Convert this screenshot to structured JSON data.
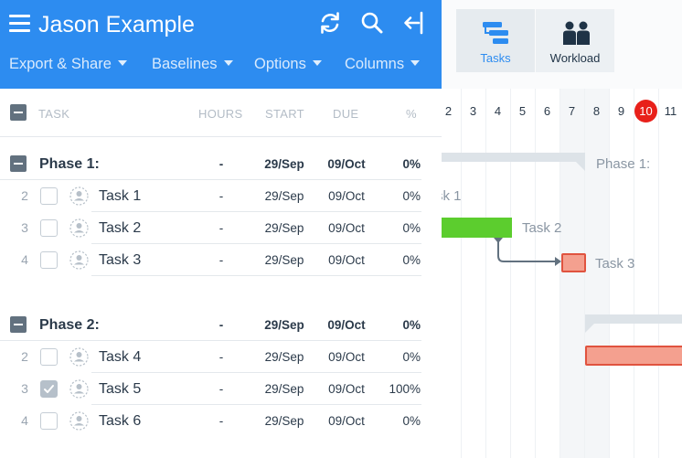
{
  "header": {
    "project_title": "Jason Example",
    "menu": [
      "Export & Share",
      "Baselines",
      "Options",
      "Columns"
    ],
    "icons": [
      "menu-icon",
      "refresh-icon",
      "search-icon",
      "collapse-panel-icon"
    ],
    "color": "#2d8cf0"
  },
  "columns": {
    "task": "TASK",
    "hours": "HOURS",
    "start": "START",
    "due": "DUE",
    "pct": "%"
  },
  "phases": [
    {
      "name": "Phase 1:",
      "hours": "-",
      "start": "29/Sep",
      "due": "09/Oct",
      "pct": "0%",
      "tasks": [
        {
          "num": "2",
          "name": "Task 1",
          "hours": "-",
          "start": "29/Sep",
          "due": "09/Oct",
          "pct": "0%",
          "checked": false
        },
        {
          "num": "3",
          "name": "Task 2",
          "hours": "-",
          "start": "29/Sep",
          "due": "09/Oct",
          "pct": "0%",
          "checked": false
        },
        {
          "num": "4",
          "name": "Task 3",
          "hours": "-",
          "start": "29/Sep",
          "due": "09/Oct",
          "pct": "0%",
          "checked": false
        }
      ]
    },
    {
      "name": "Phase 2:",
      "hours": "-",
      "start": "29/Sep",
      "due": "09/Oct",
      "pct": "0%",
      "tasks": [
        {
          "num": "2",
          "name": "Task 4",
          "hours": "-",
          "start": "29/Sep",
          "due": "09/Oct",
          "pct": "0%",
          "checked": false
        },
        {
          "num": "3",
          "name": "Task 5",
          "hours": "-",
          "start": "29/Sep",
          "due": "09/Oct",
          "pct": "100%",
          "checked": true
        },
        {
          "num": "4",
          "name": "Task 6",
          "hours": "-",
          "start": "29/Sep",
          "due": "09/Oct",
          "pct": "0%",
          "checked": false
        }
      ]
    }
  ],
  "views": {
    "tasks": {
      "label": "Tasks",
      "icon": "tasks-icon",
      "active": true
    },
    "workload": {
      "label": "Workload",
      "icon": "workload-icon",
      "active": false
    }
  },
  "gantt": {
    "days": [
      "2",
      "3",
      "4",
      "5",
      "6",
      "7",
      "8",
      "9",
      "10",
      "11"
    ],
    "today": "10",
    "labels": {
      "phase1": "Phase 1:",
      "task1": "sk 1",
      "task2": "Task 2",
      "task3": "Task 3"
    },
    "colors": {
      "complete": "#5ccd2e",
      "late": "#f4a08f",
      "late_border": "#e0533f",
      "summary": "#dde3e8",
      "arrow": "#62717f",
      "today": "#e8201a"
    }
  }
}
